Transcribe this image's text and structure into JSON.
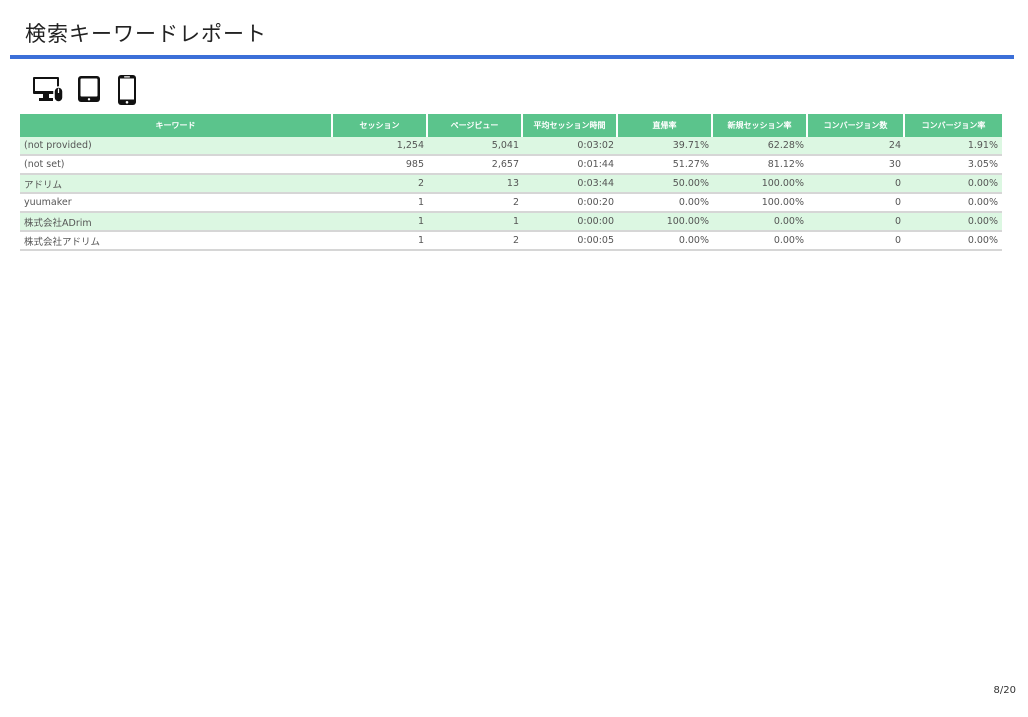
{
  "page": {
    "title": "検索キーワードレポート",
    "page_number": "8/20"
  },
  "theme": {
    "title_rule_color": "#3c6fd8",
    "header_bg": "#5bc48c",
    "row_alt_bg": "#dcf7e2",
    "row_bg": "#ffffff"
  },
  "device_icons": [
    "desktop-icon",
    "tablet-icon",
    "smartphone-icon"
  ],
  "table": {
    "columns": [
      "キーワード",
      "セッション",
      "ページビュー",
      "平均セッション時間",
      "直帰率",
      "新規セッション率",
      "コンバージョン数",
      "コンバージョン率"
    ],
    "rows": [
      [
        "(not provided)",
        "1,254",
        "5,041",
        "0:03:02",
        "39.71%",
        "62.28%",
        "24",
        "1.91%"
      ],
      [
        "(not set)",
        "985",
        "2,657",
        "0:01:44",
        "51.27%",
        "81.12%",
        "30",
        "3.05%"
      ],
      [
        "アドリム",
        "2",
        "13",
        "0:03:44",
        "50.00%",
        "100.00%",
        "0",
        "0.00%"
      ],
      [
        "yuumaker",
        "1",
        "2",
        "0:00:20",
        "0.00%",
        "100.00%",
        "0",
        "0.00%"
      ],
      [
        "株式会社ADrim",
        "1",
        "1",
        "0:00:00",
        "100.00%",
        "0.00%",
        "0",
        "0.00%"
      ],
      [
        "株式会社アドリム",
        "1",
        "2",
        "0:00:05",
        "0.00%",
        "0.00%",
        "0",
        "0.00%"
      ]
    ]
  }
}
